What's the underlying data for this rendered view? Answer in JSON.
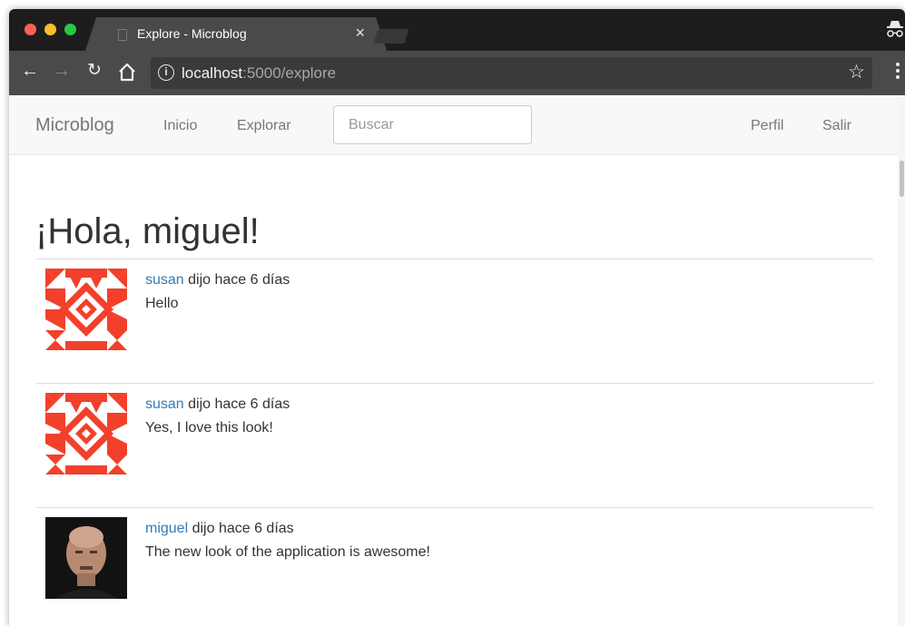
{
  "browser": {
    "tab_title": "Explore - Microblog",
    "tab_close": "×",
    "url_host": "localhost",
    "url_path": ":5000/explore",
    "icons": [
      "back-arrow-icon",
      "forward-arrow-icon",
      "reload-icon",
      "home-icon",
      "info-icon",
      "star-icon",
      "menu-icon",
      "incognito-icon"
    ]
  },
  "navbar": {
    "brand": "Microblog",
    "links": [
      "Inicio",
      "Explorar"
    ],
    "search_placeholder": "Buscar",
    "right_links": [
      "Perfil",
      "Salir"
    ]
  },
  "main": {
    "greeting": "¡Hola, miguel!",
    "posts": [
      {
        "author": "susan",
        "meta": "dijo hace 6 días",
        "body": "Hello",
        "avatar": "identicon-red"
      },
      {
        "author": "susan",
        "meta": "dijo hace 6 días",
        "body": "Yes, I love this look!",
        "avatar": "identicon-red"
      },
      {
        "author": "miguel",
        "meta": "dijo hace 6 días",
        "body": "The new look of the application is awesome!",
        "avatar": "photo"
      }
    ]
  },
  "colors": {
    "link": "#337ab7",
    "navbar_bg": "#f8f8f8",
    "identicon": "#f2402b",
    "chrome_dark": "#1d1d1d",
    "toolbar": "#4a4a4a"
  }
}
